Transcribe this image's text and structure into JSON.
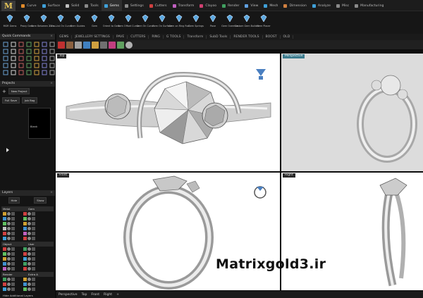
{
  "app": {
    "logo": "M"
  },
  "tabs": [
    {
      "label": "Curve",
      "color": "#e08a2a"
    },
    {
      "label": "Surface",
      "color": "#3fa0d8"
    },
    {
      "label": "Solid",
      "color": "#c0c0c0"
    },
    {
      "label": "Tools",
      "color": "#8a8a8a"
    },
    {
      "label": "Gems",
      "color": "#3fa0d8",
      "active": true
    },
    {
      "label": "Settings",
      "color": "#8a8a8a"
    },
    {
      "label": "Cutters",
      "color": "#d04040"
    },
    {
      "label": "Transform",
      "color": "#c060c0"
    },
    {
      "label": "Clayoo",
      "color": "#d04070"
    },
    {
      "label": "Render",
      "color": "#40a060"
    },
    {
      "label": "View",
      "color": "#60a0e0"
    },
    {
      "label": "Mesh",
      "color": "#3fa0d8"
    },
    {
      "label": "Dimension",
      "color": "#d08040"
    },
    {
      "label": "Analyze",
      "color": "#3fa0d8"
    },
    {
      "label": "Misc",
      "color": "#8a8a8a"
    },
    {
      "label": "Manufacturing",
      "color": "#8a8a8a"
    }
  ],
  "ribbon": [
    {
      "label": "MGR Gems",
      "icon": "gem-icon"
    },
    {
      "label": "Proxy Gem",
      "icon": "gem-icon"
    },
    {
      "label": "Gem Between 2 Cu...",
      "icon": "gem-icon"
    },
    {
      "label": "Gem List On Curve",
      "icon": "gem-icon"
    },
    {
      "label": "Gem Guides",
      "icon": "gem-icon"
    },
    {
      "label": "Gem",
      "icon": "gem-icon"
    },
    {
      "label": "Orient to Gem",
      "icon": "gem-icon"
    },
    {
      "label": "Gem Offset Curve",
      "icon": "gem-icon"
    },
    {
      "label": "Gem On Curve",
      "icon": "gem-icon"
    },
    {
      "label": "Gem On Surface",
      "icon": "gem-icon"
    },
    {
      "label": "Gem on Ring Rail",
      "icon": "gem-icon"
    },
    {
      "label": "Gem Springs",
      "icon": "gem-icon"
    },
    {
      "label": "Pave",
      "icon": "gem-icon"
    },
    {
      "label": "Gem Override",
      "icon": "gem-icon"
    },
    {
      "label": "Custom Gem Builder",
      "icon": "gem-icon"
    },
    {
      "label": "Gem Placer",
      "icon": "gem-icon"
    }
  ],
  "subtabs": [
    "GEMS",
    "JEWELLERY SETTINGS",
    "PAVE",
    "CUTTERS",
    "RING",
    "G TOOLS",
    "Transform",
    "SubD Tools",
    "RENDER TOOLS",
    "BOOST",
    "OLD"
  ],
  "quick_commands": {
    "title": "Quick Commands"
  },
  "projects": {
    "title": "Projects",
    "new_project": "New Project",
    "full_save": "Full Save",
    "job_bag": "Job Bag",
    "blank": "Blank"
  },
  "layers": {
    "title": "Layers",
    "hide": "Hide",
    "show": "Show",
    "groups": [
      {
        "name": "Metal",
        "name2": "Gem",
        "colors": [
          "#d0a030",
          "#4090d0",
          "#60c060",
          "#c0c0c0",
          "#d04040",
          "#3fa0d8"
        ]
      },
      {
        "name": "Object",
        "name2": "User",
        "colors": [
          "#d04040",
          "#60c060",
          "#d0a030",
          "#4090d0",
          "#c060c0"
        ]
      },
      {
        "name": "Render",
        "name2": "Extra A",
        "colors": [
          "#40a060",
          "#d04040",
          "#3fa0d8"
        ]
      }
    ],
    "footer": "Hide Additional Layers"
  },
  "viewports": {
    "top": "Top",
    "perspective": "Perspective",
    "front": "Front",
    "right": "Right"
  },
  "bottom_tabs": [
    "Perspective",
    "Top",
    "Front",
    "Right"
  ],
  "watermark": "Matrixgold3.ir"
}
